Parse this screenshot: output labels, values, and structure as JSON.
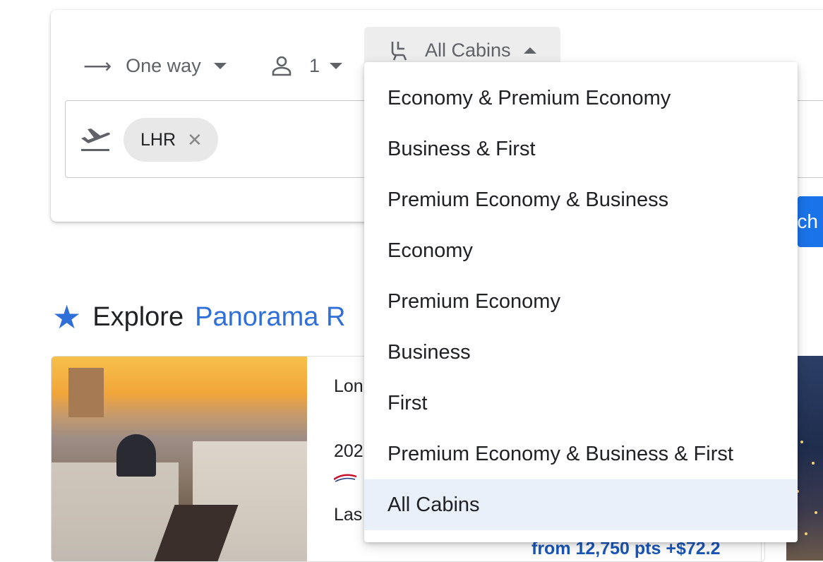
{
  "search": {
    "trip_type": "One way",
    "passengers": "1",
    "cabin": "All Cabins",
    "origin_chip": "LHR",
    "search_button_label": "rch"
  },
  "explore": {
    "label": "Explore",
    "link": "Panorama R"
  },
  "deal": {
    "line1": "Lon",
    "line2": "202",
    "line3": "Las",
    "price": "from 12,750 pts +$72.2"
  },
  "cabin_dropdown": {
    "options": [
      "Economy & Premium Economy",
      "Business & First",
      "Premium Economy & Business",
      "Economy",
      "Premium Economy",
      "Business",
      "First",
      "Premium Economy & Business & First",
      "All Cabins"
    ],
    "selected": "All Cabins"
  },
  "colors": {
    "accent": "#2f6fd8",
    "button": "#1a73e8",
    "selected_bg": "#e9f0f9"
  }
}
